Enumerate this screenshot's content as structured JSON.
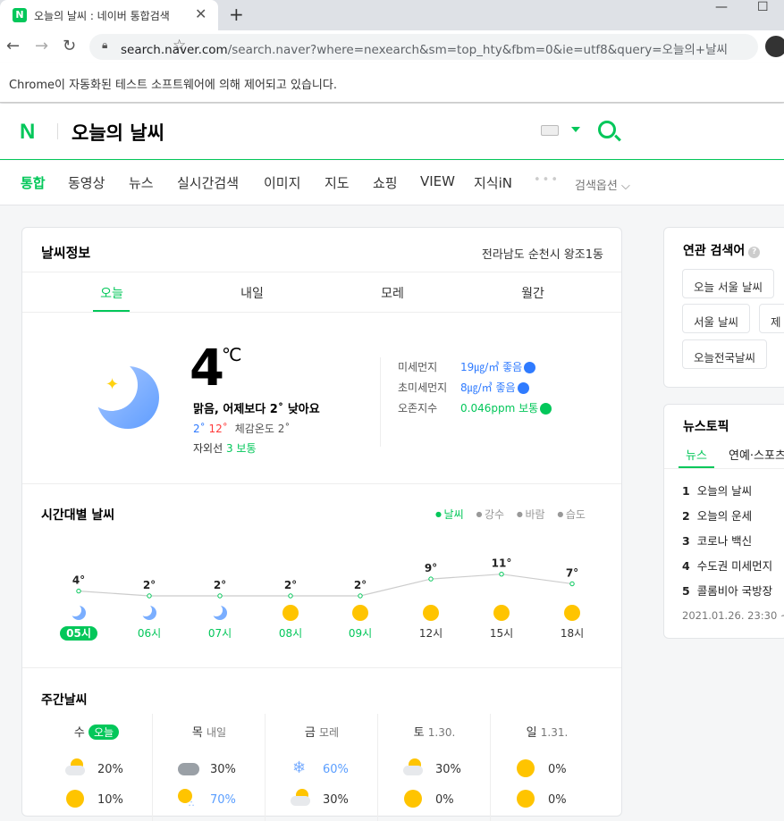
{
  "browser": {
    "tab_title": "오늘의 날씨 : 네이버 통합검색",
    "tab_favicon": "N",
    "close_glyph": "✕",
    "newtab_glyph": "+",
    "url_host": "search.naver.com",
    "url_path": "/search.naver?where=nexearch&sm=top_hty&fbm=0&ie=utf8&query=오늘의+날씨",
    "infobar_text": "Chrome이 자동화된 테스트 소프트웨어에 의해 제어되고 있습니다."
  },
  "header": {
    "logo": "N",
    "query": "오늘의 날씨"
  },
  "nav": {
    "tabs": [
      "통합",
      "동영상",
      "뉴스",
      "실시간검색",
      "이미지",
      "지도",
      "쇼핑",
      "VIEW",
      "지식iN"
    ],
    "more": "•••",
    "options": "검색옵션 ⌵"
  },
  "weather": {
    "title": "날씨정보",
    "location": "전라남도 순천시 왕조1동",
    "day_tabs": [
      "오늘",
      "내일",
      "모레",
      "월간"
    ],
    "current": {
      "temp": "4",
      "unit": "℃",
      "desc": "맑음, 어제보다 2˚ 낮아요",
      "min": "2˚",
      "max": "12˚",
      "feel": "체감온도 2˚",
      "uv_label": "자외선",
      "uv_value": "3 보통"
    },
    "air": [
      {
        "label": "미세먼지",
        "value": "19㎍/㎥ 좋음",
        "color": "#2f7bff"
      },
      {
        "label": "초미세먼지",
        "value": "8㎍/㎥ 좋음",
        "color": "#2f7bff"
      },
      {
        "label": "오존지수",
        "value": "0.046ppm 보통",
        "color": "#03c75a"
      }
    ],
    "hourly": {
      "title": "시간대별 날씨",
      "legend": [
        "날씨",
        "강수",
        "바람",
        "습도"
      ],
      "hours": [
        "05시",
        "06시",
        "07시",
        "08시",
        "09시",
        "12시",
        "15시",
        "18시"
      ],
      "temps": [
        "4°",
        "2°",
        "2°",
        "2°",
        "2°",
        "9°",
        "11°",
        "7°"
      ],
      "temp_values": [
        4,
        2,
        2,
        2,
        2,
        9,
        11,
        7
      ],
      "icons": [
        "moon",
        "moon",
        "moon",
        "sun",
        "sun",
        "sun",
        "sun",
        "sun"
      ]
    },
    "weekly": {
      "title": "주간날씨",
      "days": [
        {
          "day": "수",
          "sub": "오늘",
          "am": "20%",
          "pm": "10%",
          "am_icon": "cloud-sun",
          "pm_icon": "sun"
        },
        {
          "day": "목",
          "sub": "내일",
          "am": "30%",
          "pm": "70%",
          "am_icon": "cloud",
          "pm_icon": "sun-rain"
        },
        {
          "day": "금",
          "sub": "모레",
          "am": "60%",
          "pm": "30%",
          "am_icon": "snow",
          "pm_icon": "cloud-sun"
        },
        {
          "day": "토",
          "sub": "1.30.",
          "am": "30%",
          "pm": "0%",
          "am_icon": "cloud-sun",
          "pm_icon": "sun"
        },
        {
          "day": "일",
          "sub": "1.31.",
          "am": "0%",
          "pm": "0%",
          "am_icon": "sun",
          "pm_icon": "sun"
        }
      ]
    }
  },
  "related": {
    "title": "연관 검색어",
    "help": "?",
    "chips": [
      "오늘 서울 날씨",
      "서울 날씨",
      "제",
      "오늘전국날씨"
    ]
  },
  "news": {
    "title": "뉴스토픽",
    "tabs": [
      "뉴스",
      "연예·스포츠"
    ],
    "items": [
      "오늘의 날씨",
      "오늘의 운세",
      "코로나 백신",
      "수도권 미세먼지",
      "콜롬비아 국방장"
    ],
    "time": "2021.01.26. 23:30 ~"
  }
}
